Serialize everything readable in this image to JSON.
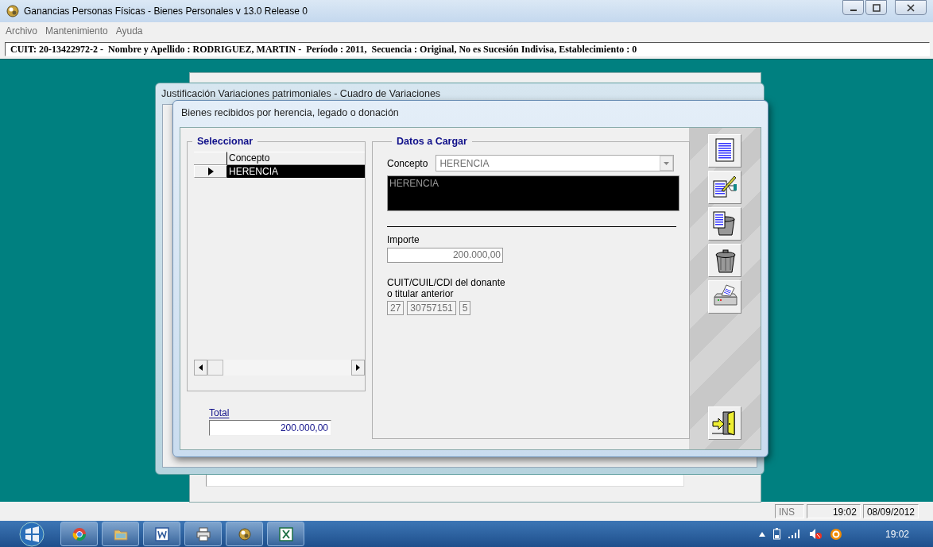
{
  "window": {
    "title": "Ganancias Personas Físicas - Bienes Personales v 13.0 Release 0"
  },
  "menu": [
    "Archivo",
    "Mantenimiento",
    "Ayuda"
  ],
  "info_bar": "CUIT: 20-13422972-2 -  Nombre y Apellido : RODRIGUEZ, MARTIN -  Período : 2011,  Secuencia : Original, No es Sucesión Indivisa, Establecimiento : 0",
  "parent_window": {
    "title": "Justificación Variaciones patrimoniales - Cuadro de Variaciones"
  },
  "dialog": {
    "title": "Bienes recibidos por herencia, legado o donación",
    "select_group": {
      "title": "Seleccionar",
      "columns": [
        "Concepto"
      ],
      "rows": [
        {
          "concepto": "HERENCIA",
          "selected": true
        }
      ]
    },
    "total": {
      "label": "Total",
      "value": "200.000,00"
    },
    "data_group": {
      "title": "Datos a Cargar",
      "concepto_label": "Concepto",
      "concepto_value": "HERENCIA",
      "description": "HERENCIA",
      "importe_label": "Importe",
      "importe_value": "200.000,00",
      "cuit_label": "CUIT/CUIL/CDI del donante\no titular anterior",
      "cuit_parts": [
        "27",
        "30757151",
        "5"
      ]
    },
    "toolbar": [
      {
        "kind": "list"
      },
      {
        "kind": "edit"
      },
      {
        "kind": "delete"
      },
      {
        "kind": "trash"
      },
      {
        "kind": "print"
      },
      {
        "kind": "exit"
      }
    ]
  },
  "status_bar": {
    "mode": "INS",
    "time": "19:02",
    "date": "08/09/2012"
  },
  "taskbar": {
    "apps": [
      {
        "kind": "browser"
      },
      {
        "kind": "folder"
      },
      {
        "kind": "word"
      },
      {
        "kind": "printer"
      },
      {
        "kind": "app"
      },
      {
        "kind": "excel"
      }
    ],
    "clock": "19:02"
  }
}
